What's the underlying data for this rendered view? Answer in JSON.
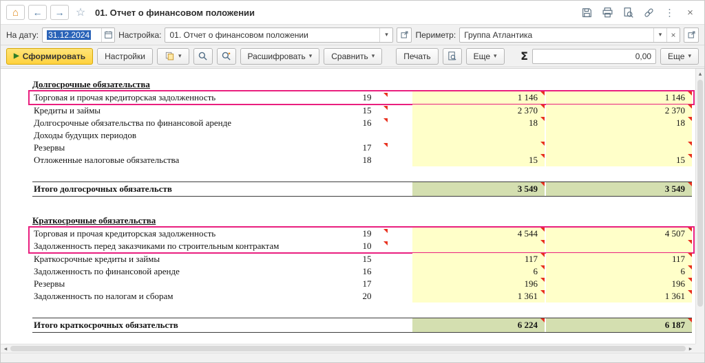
{
  "colors": {
    "value_bg": "#ffffc9",
    "total_bg": "#d4dfb0",
    "highlight": "#e91e7e",
    "marker": "#e8311f",
    "selection": "#2a63b8"
  },
  "icons": {
    "home": "⌂",
    "back": "←",
    "forward": "→",
    "star": "☆",
    "kebab": "⋮",
    "close": "×",
    "dropdown": "▾",
    "clear": "×",
    "play": "▶",
    "sum": "Σ",
    "up": "▴",
    "left": "◂",
    "right": "▸"
  },
  "titlebar": {
    "title": "01. Отчет о финансовом положении"
  },
  "filters": {
    "date_label": "На дату:",
    "date_value": "31.12.2024",
    "settings_label": "Настройка:",
    "settings_value": "01. Отчет о финансовом положении",
    "perimeter_label": "Периметр:",
    "perimeter_value": "Группа Атлантика"
  },
  "commands": {
    "generate": "Сформировать",
    "settings": "Настройки",
    "decipher": "Расшифровать",
    "compare": "Сравнить",
    "print": "Печать",
    "more_center": "Еще",
    "amount": "0,00",
    "more_right": "Еще"
  },
  "report": {
    "sections": [
      {
        "header": "Долгосрочные обязательства",
        "rows": [
          {
            "name": "Торговая и прочая кредиторская задолженность",
            "code": "19",
            "mark": true,
            "v1": "1 146",
            "m1": true,
            "v2": "1 146",
            "m2": true,
            "hl": true
          },
          {
            "name": "Кредиты и займы",
            "code": "15",
            "mark": true,
            "v1": "2 370",
            "m1": true,
            "v2": "2 370",
            "m2": true
          },
          {
            "name": "Долгосрочные обязательства по финансовой аренде",
            "code": "16",
            "mark": true,
            "v1": "18",
            "m1": true,
            "v2": "18",
            "m2": true
          },
          {
            "name": "Доходы будущих периодов",
            "code": "",
            "mark": false,
            "v1": "",
            "m1": false,
            "v2": "",
            "m2": false
          },
          {
            "name": "Резервы",
            "code": "17",
            "mark": true,
            "v1": "",
            "m1": true,
            "v2": "",
            "m2": true
          },
          {
            "name": "Отложенные налоговые обязательства",
            "code": "18",
            "mark": false,
            "v1": "15",
            "m1": true,
            "v2": "15",
            "m2": true
          }
        ],
        "total": {
          "name": "Итого долгосрочных обязательств",
          "v1": "3 549",
          "m1": true,
          "v2": "3 549",
          "m2": true
        }
      },
      {
        "header": "Краткосрочные обязательства",
        "rows": [
          {
            "name": "Торговая и прочая кредиторская задолженность",
            "code": "19",
            "mark": true,
            "v1": "4 544",
            "m1": true,
            "v2": "4 507",
            "m2": true,
            "hl": true
          },
          {
            "name": "Задолженность перед заказчиками по строительным контрактам",
            "code": "10",
            "mark": true,
            "v1": "",
            "m1": true,
            "v2": "",
            "m2": true,
            "hl": true
          },
          {
            "name": "Краткосрочные кредиты и займы",
            "code": "15",
            "mark": false,
            "v1": "117",
            "m1": true,
            "v2": "117",
            "m2": true
          },
          {
            "name": "Задолженность по финансовой аренде",
            "code": "16",
            "mark": false,
            "v1": "6",
            "m1": true,
            "v2": "6",
            "m2": true
          },
          {
            "name": "Резервы",
            "code": "17",
            "mark": false,
            "v1": "196",
            "m1": true,
            "v2": "196",
            "m2": true
          },
          {
            "name": "Задолженность по налогам и сборам",
            "code": "20",
            "mark": false,
            "v1": "1 361",
            "m1": true,
            "v2": "1 361",
            "m2": true
          }
        ],
        "total": {
          "name": "Итого краткосрочных обязательств",
          "v1": "6 224",
          "m1": true,
          "v2": "6 187",
          "m2": true
        }
      }
    ]
  }
}
